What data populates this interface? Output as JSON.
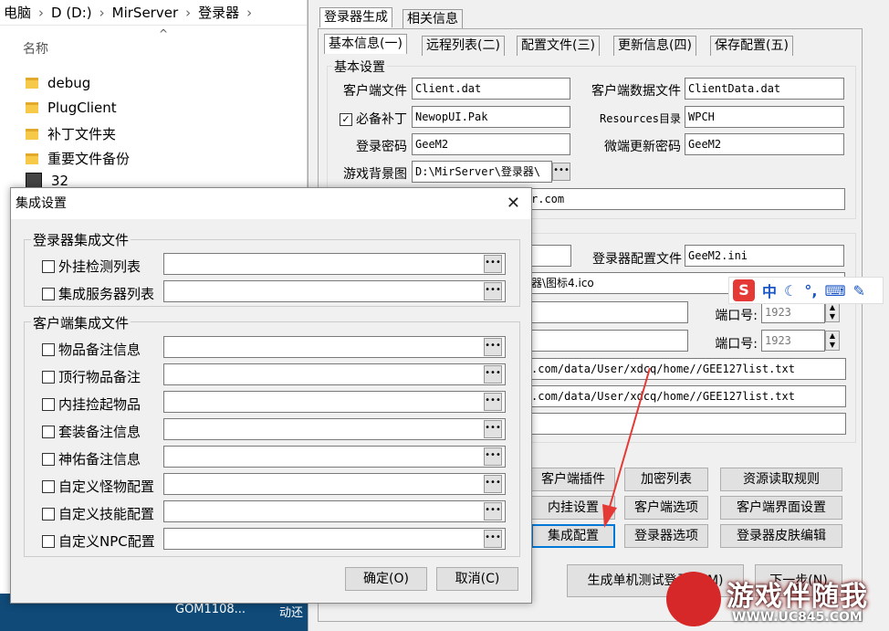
{
  "explorer": {
    "breadcrumb": [
      "电脑",
      "D (D:)",
      "MirServer",
      "登录器"
    ],
    "column_header": "名称",
    "files": [
      "debug",
      "PlugClient",
      "补丁文件夹",
      "重要文件备份",
      "32"
    ]
  },
  "taskbar": {
    "items": [
      "GOM1108...",
      "动还"
    ]
  },
  "main": {
    "top_tabs": [
      "登录器生成",
      "相关信息"
    ],
    "sub_tabs": [
      "基本信息(一)",
      "远程列表(二)",
      "配置文件(三)",
      "更新信息(四)",
      "保存配置(五)"
    ],
    "basic_group": "基本设置",
    "client_file_label": "客户端文件",
    "client_file_value": "Client.dat",
    "client_data_label": "客户端数据文件",
    "client_data_value": "ClientData.dat",
    "patch_label": "必备补丁",
    "patch_checked": "✓",
    "patch_value": "NewopUI.Pak",
    "resources_label": "Resources目录",
    "resources_value": "WPCH",
    "login_pwd_label": "登录密码",
    "login_pwd_value": "GeeM2",
    "micro_pwd_label": "微端更新密码",
    "micro_pwd_value": "GeeM2",
    "bg_label": "游戏背景图",
    "bg_value": "D:\\MirServer\\登录器\\",
    "url_fragment": "r.com",
    "login_cfg_label": "登录器配置文件",
    "login_cfg_value": "GeeM2.ini",
    "icon_value": "器\\图标4.ico",
    "port_label": "端口号:",
    "port1": "1923",
    "port2": "1923",
    "list_url1": ".com/data/User/xdcq/home//GEE127list.txt",
    "list_url2": ".com/data/User/xdcq/home//GEE127list.txt",
    "buttons": {
      "client_plugin": "客户端插件",
      "encrypt_list": "加密列表",
      "resource_rules": "资源读取规则",
      "embedded_settings": "内挂设置",
      "client_options": "客户端选项",
      "client_ui_settings": "客户端界面设置",
      "integration_config": "集成配置",
      "login_options": "登录器选项",
      "login_skin_edit": "登录器皮肤编辑",
      "gen_test_login": "生成单机测试登录器(M)",
      "next_step": "下一步(N)"
    }
  },
  "ime": {
    "brand": "S",
    "mode": "中"
  },
  "dialog": {
    "title": "集成设置",
    "close_glyph": "✕",
    "group1": "登录器集成文件",
    "group1_items": [
      "外挂检测列表",
      "集成服务器列表"
    ],
    "group2": "客户端集成文件",
    "group2_items": [
      "物品备注信息",
      "顶行物品备注",
      "内挂捡起物品",
      "套装备注信息",
      "神佑备注信息",
      "自定义怪物配置",
      "自定义技能配置",
      "自定义NPC配置"
    ],
    "ok": "确定(O)",
    "cancel": "取消(C)"
  },
  "watermark": {
    "title": "游戏伴随我",
    "url": "WWW.UC845.COM"
  }
}
